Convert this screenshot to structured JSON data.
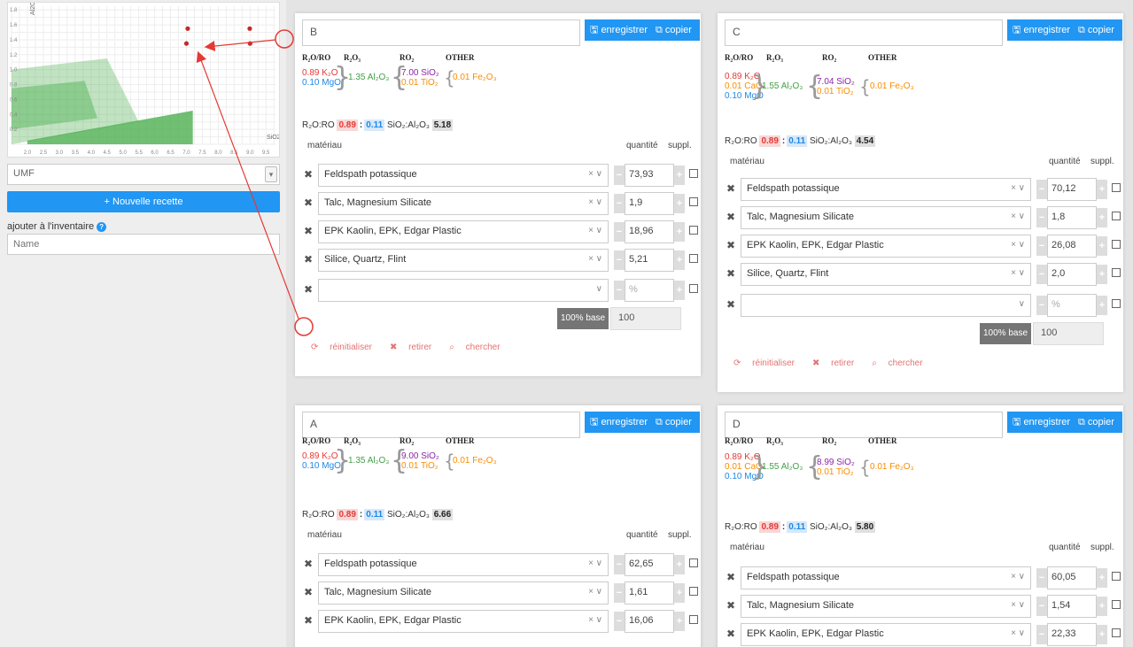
{
  "chart_data": {
    "type": "scatter",
    "xlabel": "SiO2",
    "ylabel": "Al2O3",
    "x_ticks": [
      "2.0",
      "2.5",
      "3.0",
      "3.5",
      "4.0",
      "4.5",
      "5.0",
      "5.5",
      "6.0",
      "6.5",
      "7.0",
      "7.5",
      "8.0",
      "8.5",
      "9.0",
      "9.5"
    ],
    "y_ticks": [
      "1.8",
      "1.6",
      "1.4",
      "1.2",
      "1.0",
      "0.8",
      "0.6",
      "0.4",
      "0.2"
    ],
    "xlim": [
      1.5,
      9.8
    ],
    "ylim": [
      0,
      1.85
    ],
    "points": [
      {
        "x": 7.04,
        "y": 1.55
      },
      {
        "x": 7.0,
        "y": 1.35
      },
      {
        "x": 8.99,
        "y": 1.55
      },
      {
        "x": 9.0,
        "y": 1.35
      }
    ]
  },
  "left": {
    "select_value": "UMF",
    "new_recipe": "+ Nouvelle recette",
    "inventory_label": "ajouter à l'inventaire",
    "name_placeholder": "Name"
  },
  "labels": {
    "save": "enregistrer",
    "copy": "copier",
    "h_ro": "R₂O/RO",
    "h_r2o3": "R₂O₃",
    "h_ro2": "RO₂",
    "h_other": "OTHER",
    "ratio_prefix": "R₂O:RO",
    "ratio_sep": ":",
    "sial_label": "SiO₂:Al₂O₃",
    "materiau": "matériau",
    "quantite": "quantité",
    "suppl": "suppl.",
    "base_btn": "100% base",
    "base_val": "100",
    "pct": "%",
    "reset": "réinitialiser",
    "remove": "retirer",
    "search": "chercher"
  },
  "cards": {
    "B": {
      "name": "B",
      "ro": [
        "0.89 K₂O",
        "0.10 MgO"
      ],
      "r2o3": "1.35 Al₂O₃",
      "ro2": [
        "7.00 SiO₂",
        "0.01 TiO₂"
      ],
      "other": "0.01 Fe₂O₃",
      "r1": "0.89",
      "r2": "0.11",
      "sial": "5.18",
      "rows": [
        {
          "name": "Feldspath potassique",
          "qty": "73,93"
        },
        {
          "name": "Talc, Magnesium Silicate",
          "qty": "1,9"
        },
        {
          "name": "EPK Kaolin, EPK, Edgar Plastic",
          "qty": "18,96"
        },
        {
          "name": "Silice, Quartz, Flint",
          "qty": "5,21"
        }
      ]
    },
    "C": {
      "name": "C",
      "ro": [
        "0.89 K₂O",
        "0.01 CaO",
        "0.10 MgO"
      ],
      "r2o3": "1.55 Al₂O₃",
      "ro2": [
        "7.04 SiO₂",
        "0.01 TiO₂"
      ],
      "other": "0.01 Fe₂O₃",
      "r1": "0.89",
      "r2": "0.11",
      "sial": "4.54",
      "rows": [
        {
          "name": "Feldspath potassique",
          "qty": "70,12"
        },
        {
          "name": "Talc, Magnesium Silicate",
          "qty": "1,8"
        },
        {
          "name": "EPK Kaolin, EPK, Edgar Plastic",
          "qty": "26,08"
        },
        {
          "name": "Silice, Quartz, Flint",
          "qty": "2,0"
        }
      ]
    },
    "A": {
      "name": "A",
      "ro": [
        "0.89 K₂O",
        "0.10 MgO"
      ],
      "r2o3": "1.35 Al₂O₃",
      "ro2": [
        "9.00 SiO₂",
        "0.01 TiO₂"
      ],
      "other": "0.01 Fe₂O₃",
      "r1": "0.89",
      "r2": "0.11",
      "sial": "6.66",
      "rows": [
        {
          "name": "Feldspath potassique",
          "qty": "62,65"
        },
        {
          "name": "Talc, Magnesium Silicate",
          "qty": "1,61"
        },
        {
          "name": "EPK Kaolin, EPK, Edgar Plastic",
          "qty": "16,06"
        }
      ]
    },
    "D": {
      "name": "D",
      "ro": [
        "0.89 K₂O",
        "0.01 CaO",
        "0.10 MgO"
      ],
      "r2o3": "1.55 Al₂O₃",
      "ro2": [
        "8.99 SiO₂",
        "0.01 TiO₂"
      ],
      "other": "0.01 Fe₂O₃",
      "r1": "0.89",
      "r2": "0.11",
      "sial": "5.80",
      "rows": [
        {
          "name": "Feldspath potassique",
          "qty": "60,05"
        },
        {
          "name": "Talc, Magnesium Silicate",
          "qty": "1,54"
        },
        {
          "name": "EPK Kaolin, EPK, Edgar Plastic",
          "qty": "22,33"
        }
      ]
    }
  },
  "colors": {
    "accent": "#2196f3",
    "annotation": "#e53935",
    "point": "#c62828",
    "area": "#4caf50"
  }
}
